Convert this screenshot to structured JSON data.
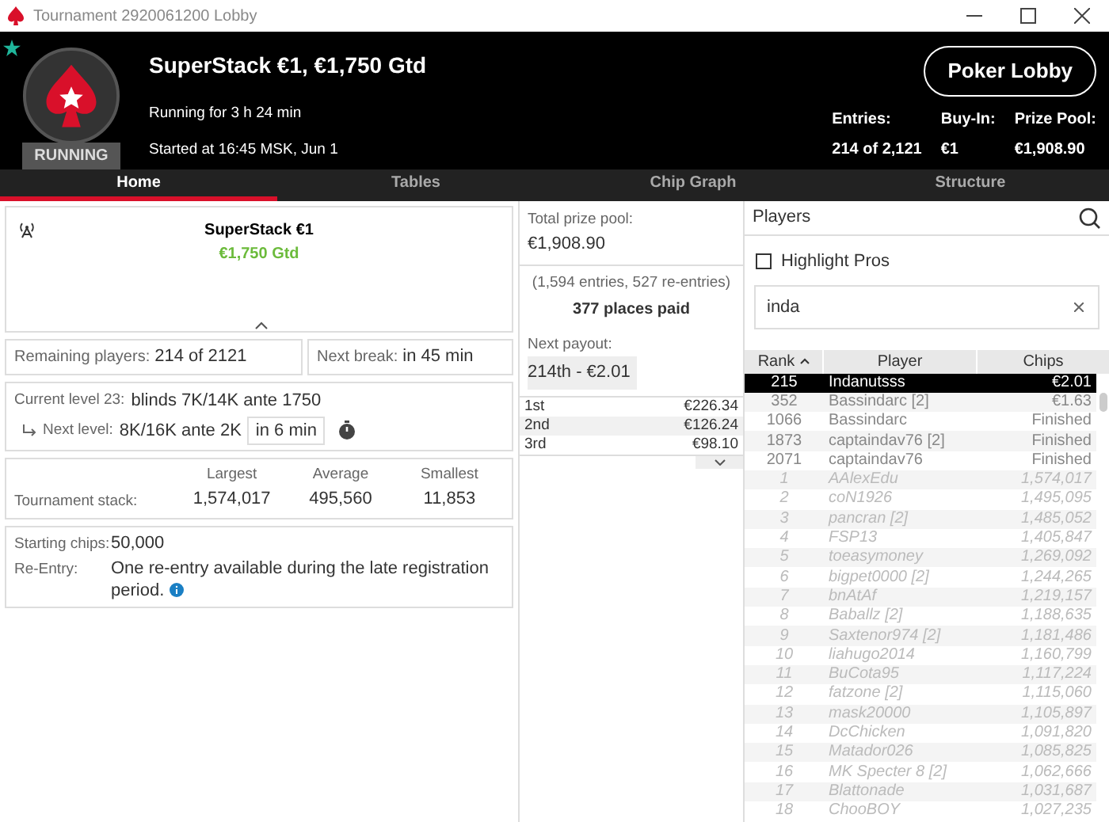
{
  "window": {
    "title": "Tournament 2920061200 Lobby"
  },
  "header": {
    "title": "SuperStack €1, €1,750 Gtd",
    "status": "RUNNING",
    "running_for": "Running for 3 h 24 min",
    "started": "Started at 16:45 MSK, Jun 1",
    "lobby_button": "Poker Lobby",
    "stats": [
      {
        "label": "Entries:",
        "value": "214 of 2,121"
      },
      {
        "label": "Buy-In:",
        "value": "€1"
      },
      {
        "label": "Prize Pool:",
        "value": "€1,908.90"
      }
    ]
  },
  "tabs": [
    {
      "label": "Home",
      "selected": true
    },
    {
      "label": "Tables",
      "selected": false
    },
    {
      "label": "Chip Graph",
      "selected": false
    },
    {
      "label": "Structure",
      "selected": false
    }
  ],
  "summary": {
    "name": "SuperStack €1",
    "guarantee": "€1,750 Gtd"
  },
  "remaining": {
    "label": "Remaining players:",
    "value": "214 of 2121"
  },
  "next_break": {
    "label": "Next break:",
    "value": "in 45 min"
  },
  "level": {
    "current_label": "Current level 23:",
    "current": "blinds 7K/14K ante 1750",
    "next_label": "Next level:",
    "next": "8K/16K ante 2K",
    "next_in": "in 6 min"
  },
  "stack": {
    "label": "Tournament stack:",
    "columns": [
      {
        "heading": "Largest",
        "value": "1,574,017"
      },
      {
        "heading": "Average",
        "value": "495,560"
      },
      {
        "heading": "Smallest",
        "value": "11,853"
      }
    ]
  },
  "info": [
    {
      "label": "Starting chips:",
      "value": "50,000",
      "info_icon": false
    },
    {
      "label": "Re-Entry:",
      "value": "One re-entry available during the late registration period.",
      "info_icon": true
    }
  ],
  "prize": {
    "total_label": "Total prize pool:",
    "total": "€1,908.90",
    "entries": "(1,594 entries, 527 re-entries)",
    "places": "377 places paid",
    "next_label": "Next payout:",
    "next": "214th - €2.01",
    "payouts": [
      {
        "place": "1st",
        "amount": "€226.34"
      },
      {
        "place": "2nd",
        "amount": "€126.24"
      },
      {
        "place": "3rd",
        "amount": "€98.10"
      }
    ]
  },
  "players": {
    "title": "Players",
    "highlight": {
      "label": "Highlight Pros",
      "checked": false
    },
    "search": {
      "value": "inda"
    },
    "columns": [
      "Rank",
      "Player",
      "Chips"
    ],
    "rows": [
      {
        "rank": "215",
        "player": "Indanutsss",
        "chips": "€2.01",
        "selected": true,
        "kind": "match"
      },
      {
        "rank": "352",
        "player": "Bassindarc [2]",
        "chips": "€1.63",
        "selected": false,
        "kind": "match"
      },
      {
        "rank": "1066",
        "player": "Bassindarc",
        "chips": "Finished",
        "selected": false,
        "kind": "match"
      },
      {
        "rank": "1873",
        "player": "captaindav76 [2]",
        "chips": "Finished",
        "selected": false,
        "kind": "match"
      },
      {
        "rank": "2071",
        "player": "captaindav76",
        "chips": "Finished",
        "selected": false,
        "kind": "match"
      },
      {
        "rank": "1",
        "player": "AAlexEdu",
        "chips": "1,574,017",
        "selected": false,
        "kind": "other"
      },
      {
        "rank": "2",
        "player": "coN1926",
        "chips": "1,495,095",
        "selected": false,
        "kind": "other"
      },
      {
        "rank": "3",
        "player": "pancran [2]",
        "chips": "1,485,052",
        "selected": false,
        "kind": "other"
      },
      {
        "rank": "4",
        "player": "FSP13",
        "chips": "1,405,847",
        "selected": false,
        "kind": "other"
      },
      {
        "rank": "5",
        "player": "toeasymoney",
        "chips": "1,269,092",
        "selected": false,
        "kind": "other"
      },
      {
        "rank": "6",
        "player": "bigpet0000 [2]",
        "chips": "1,244,265",
        "selected": false,
        "kind": "other"
      },
      {
        "rank": "7",
        "player": "bnAtAf",
        "chips": "1,219,157",
        "selected": false,
        "kind": "other"
      },
      {
        "rank": "8",
        "player": "Baballz [2]",
        "chips": "1,188,635",
        "selected": false,
        "kind": "other"
      },
      {
        "rank": "9",
        "player": "Saxtenor974 [2]",
        "chips": "1,181,486",
        "selected": false,
        "kind": "other"
      },
      {
        "rank": "10",
        "player": "liahugo2014",
        "chips": "1,160,799",
        "selected": false,
        "kind": "other"
      },
      {
        "rank": "11",
        "player": "BuCota95",
        "chips": "1,117,224",
        "selected": false,
        "kind": "other"
      },
      {
        "rank": "12",
        "player": "fatzone [2]",
        "chips": "1,115,060",
        "selected": false,
        "kind": "other"
      },
      {
        "rank": "13",
        "player": "mask20000",
        "chips": "1,105,897",
        "selected": false,
        "kind": "other"
      },
      {
        "rank": "14",
        "player": "DcChicken",
        "chips": "1,091,820",
        "selected": false,
        "kind": "other"
      },
      {
        "rank": "15",
        "player": "Matador026",
        "chips": "1,085,825",
        "selected": false,
        "kind": "other"
      },
      {
        "rank": "16",
        "player": "MK Specter 8 [2]",
        "chips": "1,062,666",
        "selected": false,
        "kind": "other"
      },
      {
        "rank": "17",
        "player": "Blattonade",
        "chips": "1,031,687",
        "selected": false,
        "kind": "other"
      },
      {
        "rank": "18",
        "player": "ChooBOY",
        "chips": "1,027,235",
        "selected": false,
        "kind": "other"
      }
    ]
  }
}
